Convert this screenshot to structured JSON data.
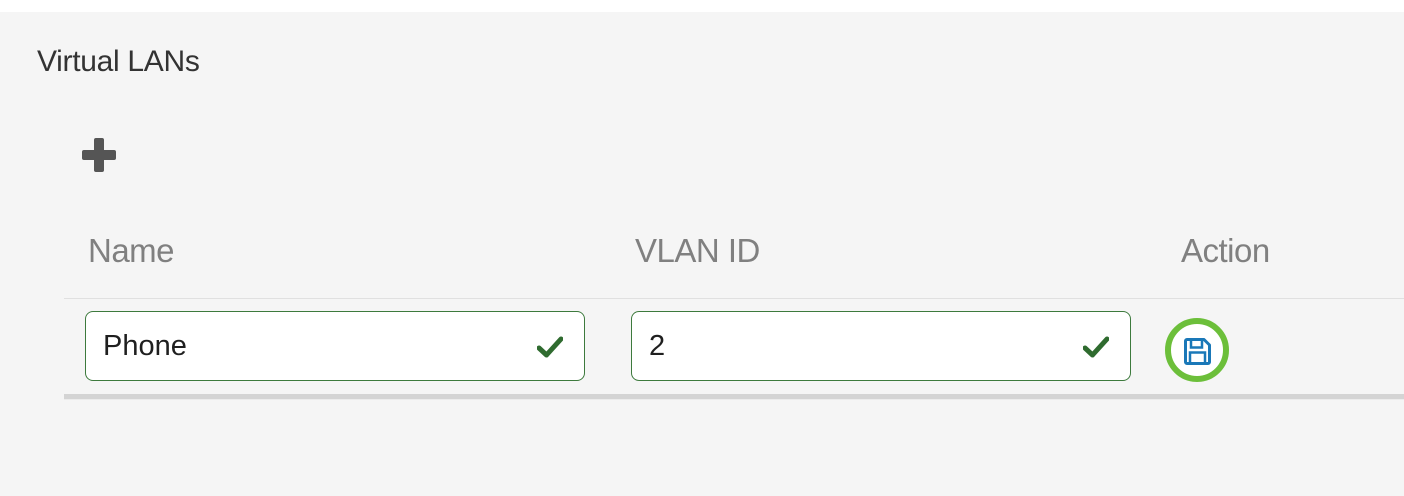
{
  "panel": {
    "title": "Virtual LANs"
  },
  "toolbar": {
    "add_icon": "plus-icon"
  },
  "table": {
    "columns": [
      "Name",
      "VLAN ID",
      "Action"
    ],
    "rows": [
      {
        "name": "Phone",
        "name_status": "valid",
        "vlan_id": "2",
        "vlan_id_status": "valid",
        "action_icon": "save-icon"
      }
    ]
  },
  "colors": {
    "valid_check": "#2f6b2f",
    "field_border": "#3d7a3d",
    "save_highlight": "#6cbf3a",
    "save_icon": "#1a78b8",
    "add_icon": "#555555"
  }
}
